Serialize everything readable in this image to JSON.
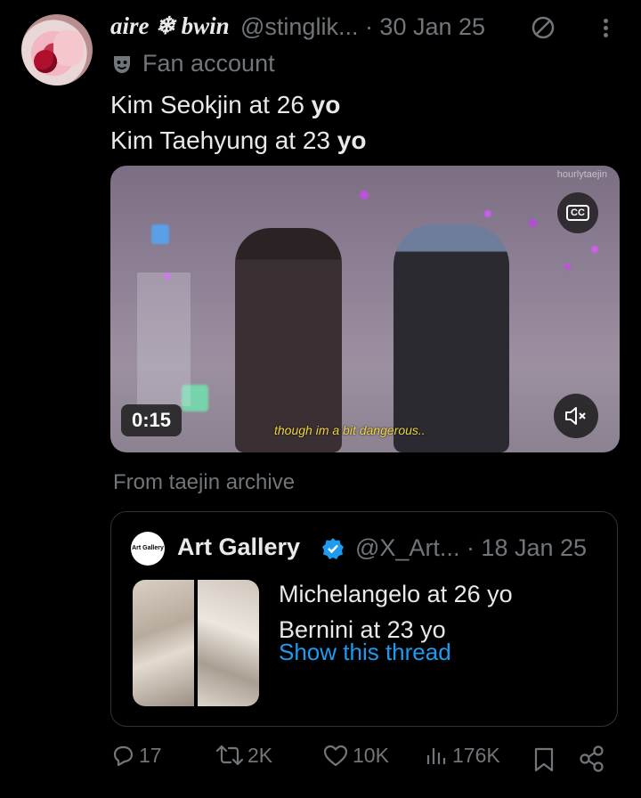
{
  "post": {
    "display_name": "aire ❄ bwin",
    "handle_date": "@stinglik... · 30 Jan 25",
    "badge_label": "Fan account",
    "text_line1_prefix": "Kim Seokjin at 26 ",
    "text_line1_bold": "yo",
    "text_line2_prefix": "Kim Taehyung at 23 ",
    "text_line2_bold": "yo"
  },
  "video": {
    "watermark": "hourlytaejin",
    "cc_label": "CC",
    "duration": "0:15",
    "subtitle": "though im a bit dangerous.."
  },
  "source_label": "From taejin archive",
  "quote": {
    "avatar_text": "Art Gallery",
    "name": "Art Gallery",
    "handle_date": "@X_Art... · 18 Jan 25",
    "line1": "Michelangelo at 26 yo",
    "line2": "Bernini at 23 yo",
    "show_thread": "Show this thread"
  },
  "actions": {
    "replies": "17",
    "reposts": "2K",
    "likes": "10K",
    "views": "176K"
  },
  "colors": {
    "background": "#000000",
    "text": "#e7e9ea",
    "secondary": "#71767b",
    "link": "#1d9bf0",
    "border": "#2f3336"
  }
}
